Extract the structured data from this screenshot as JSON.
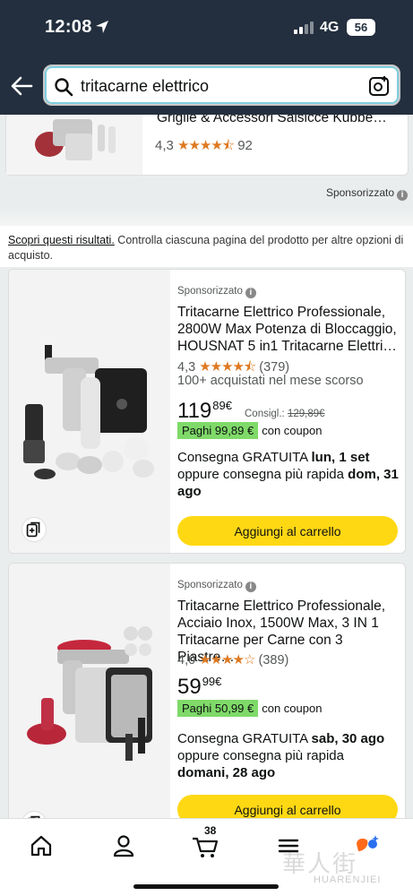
{
  "status_bar": {
    "time": "12:08",
    "network": "4G",
    "battery": "56"
  },
  "search": {
    "query": "tritacarne elettrico"
  },
  "previous_result": {
    "title": "Griglie & Accessori Salsicce Kubbe…",
    "rating": "4,3",
    "stars": "★★★★⯪",
    "reviews": "92"
  },
  "sponsored_label": "Sponsorizzato",
  "discover": {
    "link": "Scopri questi risultati.",
    "text": " Controlla ciascuna pagina del prodotto per altre opzioni di acquisto."
  },
  "products": [
    {
      "sponsored": "Sponsorizzato",
      "title": "Tritacarne Elettrico Professionale, 2800W Max Potenza di Bloccaggio, HOUSNAT 5 in1 Tritacarne Elettri…",
      "rating": "4,3",
      "stars": "★★★★⯪",
      "reviews": "(379)",
      "bought": "100+ acquistati nel mese scorso",
      "price_whole": "119",
      "price_fraction": "89",
      "currency": "€",
      "list_label": "Consigl.:",
      "list_price": "129,89€",
      "coupon_pay": "Paghi 99,89 €",
      "coupon_text": "con coupon",
      "delivery_prefix": "Consegna GRATUITA ",
      "delivery_date": "lun, 1 set",
      "delivery_fast_prefix": "oppure consegna più rapida ",
      "delivery_fast_date": "dom, 31 ago",
      "cart_label": "Aggiungi al carrello"
    },
    {
      "sponsored": "Sponsorizzato",
      "title": "Tritacarne Elettrico Professionale, Acciaio Inox, 1500W Max, 3 IN 1 Tritacarne per Carne con 3 Piastre…",
      "rating": "4,0",
      "stars": "★★★★☆",
      "reviews": "(389)",
      "price_whole": "59",
      "price_fraction": "99",
      "currency": "€",
      "coupon_pay": "Paghi 50,99 €",
      "coupon_text": "con coupon",
      "delivery_prefix": "Consegna GRATUITA ",
      "delivery_date": "sab, 30 ago",
      "delivery_fast_prefix": "oppure consegna più rapida ",
      "delivery_fast_date": "domani, 28 ago",
      "cart_label": "Aggiungi al carrello"
    }
  ],
  "bottom_nav": {
    "cart_count": "38"
  },
  "watermark": {
    "text": "華人街",
    "sub": "HUARENJIEI"
  },
  "colors": {
    "header": "#232f3e",
    "button": "#ffd814",
    "stars": "#de7921",
    "coupon": "#7fda69"
  }
}
